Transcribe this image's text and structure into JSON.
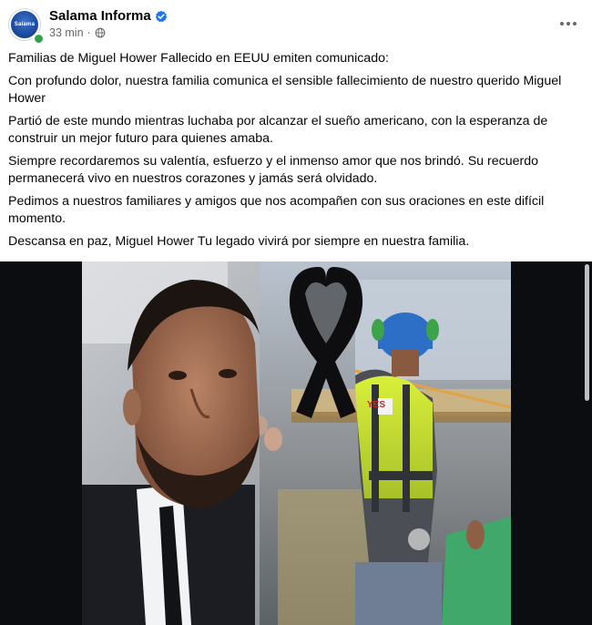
{
  "post": {
    "page_name": "Salama Informa",
    "avatar_text": "Salama",
    "timestamp": "33 min",
    "separator": "·",
    "paragraphs": [
      "Familias de Miguel  Hower Fallecido en EEUU emiten comunicado:",
      "Con profundo dolor, nuestra familia comunica el sensible fallecimiento de nuestro querido Miguel Hower",
      "Partió de este mundo mientras luchaba por alcanzar el sueño americano, con la esperanza de construir un mejor futuro para quienes amaba.",
      "Siempre recordaremos su valentía, esfuerzo y el inmenso amor que nos brindó. Su recuerdo permanecerá vivo en nuestros corazones y jamás será olvidado.",
      "Pedimos a nuestros familiares y amigos que nos acompañen con sus oraciones en este difícil momento.",
      "Descansa en paz, Miguel Hower Tu legado vivirá por siempre en nuestra familia."
    ],
    "image_badge": "YES",
    "icons": {
      "verified": "verified-badge-icon",
      "audience": "globe-icon",
      "more": "more-options-icon",
      "ribbon": "black-mourning-ribbon-icon"
    },
    "colors": {
      "verified_blue": "#1877f2",
      "online_green": "#31a24c",
      "meta_gray": "#65676b"
    }
  }
}
